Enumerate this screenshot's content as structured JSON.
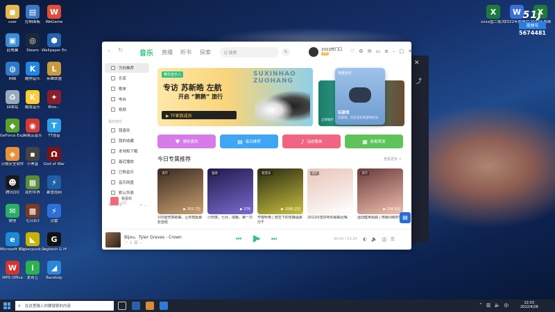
{
  "desktop": {
    "col1": [
      {
        "label": "user",
        "color": "#e6b84c",
        "glyph": "◼"
      },
      {
        "label": "此电脑",
        "color": "#3a8bd8",
        "glyph": "▣"
      },
      {
        "label": "网络",
        "color": "#2f79c9",
        "glyph": "◍"
      },
      {
        "label": "回收站",
        "color": "#9ab",
        "glyph": "♻"
      },
      {
        "label": "GeForce Experience",
        "color": "#5aa02c",
        "glyph": "◆"
      },
      {
        "label": "火绒安全软件",
        "color": "#e8913a",
        "glyph": "◈"
      },
      {
        "label": "腾讯QQ",
        "color": "#1a1a1a",
        "glyph": "☻"
      },
      {
        "label": "微信",
        "color": "#2aae67",
        "glyph": "✉"
      },
      {
        "label": "Microsoft Edge",
        "color": "#1c8ad6",
        "glyph": "e"
      },
      {
        "label": "WPS Office",
        "color": "#d6332c",
        "glyph": "W"
      }
    ],
    "col2": [
      {
        "label": "控制面板",
        "color": "#3b78c2",
        "glyph": "▤"
      },
      {
        "label": "Steam",
        "color": "#1b2838",
        "glyph": "◎"
      },
      {
        "label": "酷狗音乐",
        "color": "#1f86e5",
        "glyph": "K"
      },
      {
        "label": "酷我音乐",
        "color": "#ffcc33",
        "glyph": "K"
      },
      {
        "label": "网易云音乐",
        "color": "#d43c33",
        "glyph": "◉"
      },
      {
        "label": "小黑盒",
        "color": "#444",
        "glyph": "▪"
      },
      {
        "label": "我的世界",
        "color": "#5b8c3a",
        "glyph": "▦"
      },
      {
        "label": "七日杀2",
        "color": "#7a3b22",
        "glyph": "▩"
      },
      {
        "label": "Cyberpunk 2077",
        "color": "#c8b400",
        "glyph": "◣"
      },
      {
        "label": "爱奇艺",
        "color": "#2bb24c",
        "glyph": "i"
      }
    ],
    "col3": [
      {
        "label": "WeGame",
        "color": "#e24c3b",
        "glyph": "W"
      },
      {
        "label": "Wallpaper Engine",
        "color": "#2464b0",
        "glyph": "⬢"
      },
      {
        "label": "英雄联盟",
        "color": "#c89b3c",
        "glyph": "L"
      },
      {
        "label": "Bloo...",
        "color": "#8a1e2a",
        "glyph": "✦"
      },
      {
        "label": "TT语音",
        "color": "#2fa0e6",
        "glyph": "T"
      },
      {
        "label": "God of War",
        "color": "#7a1414",
        "glyph": "Ω"
      },
      {
        "label": "暴雪战网",
        "color": "#1e5fa8",
        "glyph": "⚡"
      },
      {
        "label": "迅雷",
        "color": "#2e6fd6",
        "glyph": "⚡"
      },
      {
        "label": "Logitech G HUB",
        "color": "#111",
        "glyph": "G"
      },
      {
        "label": "Bandizip",
        "color": "#2b87d8",
        "glyph": "◢"
      }
    ],
    "right": [
      {
        "label": "xxxx国二批次填",
        "color": "#1f7a3a",
        "glyph": "X"
      },
      {
        "label": "2022年成绩文件",
        "color": "#3a6fd6",
        "glyph": "W"
      },
      {
        "label": "2022年成绩",
        "color": "#1f7a3a",
        "glyph": "X"
      }
    ],
    "watermark": {
      "brand": "51J",
      "account": "视频号",
      "id": "5674481"
    }
  },
  "app": {
    "tabs": {
      "music": "音乐",
      "live": "直播",
      "listen": "听书",
      "explore": "探索"
    },
    "search_placeholder": "Q 搜索",
    "user": {
      "name": "2022的门口",
      "vip": "VIP"
    },
    "sidebar": {
      "online": [
        {
          "label": "为你推荐",
          "active": true
        },
        {
          "label": "乐库"
        },
        {
          "label": "歌单"
        },
        {
          "label": "电台"
        },
        {
          "label": "视频"
        }
      ],
      "mine_header": "我的音乐",
      "mine": [
        {
          "label": "我喜欢"
        },
        {
          "label": "我的收藏"
        },
        {
          "label": "本地和下载"
        },
        {
          "label": "最近播放"
        },
        {
          "label": "已购音乐"
        },
        {
          "label": "音乐网盘"
        },
        {
          "label": "默认列表"
        }
      ],
      "created_header": "我的歌单",
      "created_actions": "+ ⌄",
      "fav": {
        "label": "我喜欢",
        "sub": "0首"
      }
    },
    "banner": {
      "tag": "腾讯音乐人",
      "title": "专访 苏新皓 左航",
      "subtitle": "开启 “鹅鹅” 旅行",
      "bar": "▶ TF家族成员",
      "english": "SUXINHAO ZUOHANG"
    },
    "game_card": {
      "label": "场景音乐",
      "title": "玩游戏",
      "sub": "玩游戏，开启音乐和游戏时光"
    },
    "banner2_label": "立即收听",
    "quick_buttons": [
      {
        "label": "猜你喜欢",
        "color": "#d67ce8",
        "icon": "♥"
      },
      {
        "label": "每日推荐",
        "color": "#3fa5f5",
        "icon": "▤"
      },
      {
        "label": "动态歌单",
        "color": "#f06582",
        "icon": "♪"
      },
      {
        "label": "新歌首发",
        "color": "#5ec35a",
        "icon": "▦"
      }
    ],
    "section_title": "今日专属推荐",
    "section_more": "查看更多 >",
    "cards": [
      {
        "tag": "流行",
        "plays": "▶ 352.7万",
        "caption": "100首伤感歌曲，让你想起那些曾经",
        "c1": "#3a2a22",
        "c2": "#c9a070"
      },
      {
        "tag": "国语",
        "plays": "▶ 276",
        "caption": "小伤感，七月，成都，第一次",
        "c1": "#1f1a4a",
        "c2": "#7a6ad0"
      },
      {
        "tag": "轻音乐",
        "plays": "▶ 1085.2万",
        "caption": "开窗听雨 | 放空下的安静温柔万千",
        "c1": "#2a2a10",
        "c2": "#c8c040"
      },
      {
        "tag": "流行",
        "plays": "▶ 101.7万",
        "caption": "2022抖音好听的歌曲合辑",
        "c1": "#e8c4b8",
        "c2": "#fff"
      },
      {
        "tag": "流行",
        "plays": "▶ 256.5万",
        "caption": "运动健身配曲 | 燃爆训练时刻",
        "c1": "#6a3a3a",
        "c2": "#f0c0b0"
      }
    ],
    "player": {
      "title": "Bijou、Tyler Graves - Crown",
      "time": "00:00 / 03:24",
      "icons": "♡ ⇩ ☰ ⋯"
    }
  },
  "taskbar": {
    "search_placeholder": "在这里输入你要搜索的内容",
    "time": "22:03",
    "date": "2022/4/28",
    "tray_lang": "中"
  }
}
